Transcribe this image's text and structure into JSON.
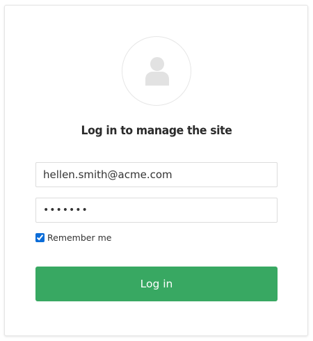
{
  "form": {
    "title": "Log in to manage the site",
    "avatar_icon": "user-silhouette-icon",
    "email_value": "hellen.smith@acme.com",
    "password_value": "•••••••",
    "remember_label": "Remember me",
    "remember_checked": true,
    "login_label": "Log in"
  },
  "colors": {
    "button": "#38a862",
    "checkbox_accent": "#0a6cd8",
    "avatar_icon": "#e2e2e2"
  }
}
